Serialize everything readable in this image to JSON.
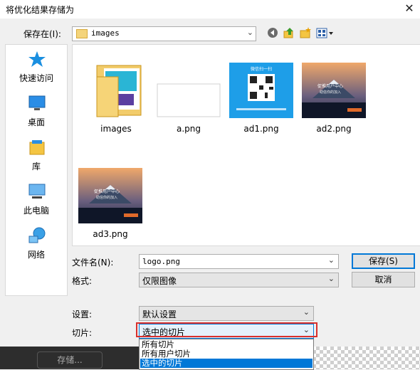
{
  "dialog": {
    "title": "将优化结果存储为"
  },
  "location": {
    "label": "保存在(I):",
    "value": "images"
  },
  "sidebar": {
    "items": [
      {
        "label": "快速访问",
        "icon": "star-icon"
      },
      {
        "label": "桌面",
        "icon": "desktop-icon"
      },
      {
        "label": "库",
        "icon": "library-icon"
      },
      {
        "label": "此电脑",
        "icon": "computer-icon"
      },
      {
        "label": "网络",
        "icon": "network-icon"
      }
    ]
  },
  "files": [
    {
      "name": "images",
      "type": "folder"
    },
    {
      "name": "a.png",
      "type": "image-blank"
    },
    {
      "name": "ad1.png",
      "type": "image-qr"
    },
    {
      "name": "ad2.png",
      "type": "image-mountain"
    },
    {
      "name": "ad3.png",
      "type": "image-mountain"
    }
  ],
  "thumb_text": {
    "qr_title": "微信扫一扫",
    "mountain_title": "促推用户中心",
    "mountain_sub": "助信你的加入"
  },
  "filename": {
    "label": "文件名(N):",
    "value": "logo.png"
  },
  "format": {
    "label": "格式:",
    "value": "仅限图像"
  },
  "buttons": {
    "save": "保存(S)",
    "cancel": "取消"
  },
  "settings": {
    "label": "设置:",
    "value": "默认设置"
  },
  "slices": {
    "label": "切片:",
    "value": "选中的切片",
    "options": [
      "所有切片",
      "所有用户切片",
      "选中的切片"
    ]
  },
  "background": {
    "store_button": "存储..."
  }
}
